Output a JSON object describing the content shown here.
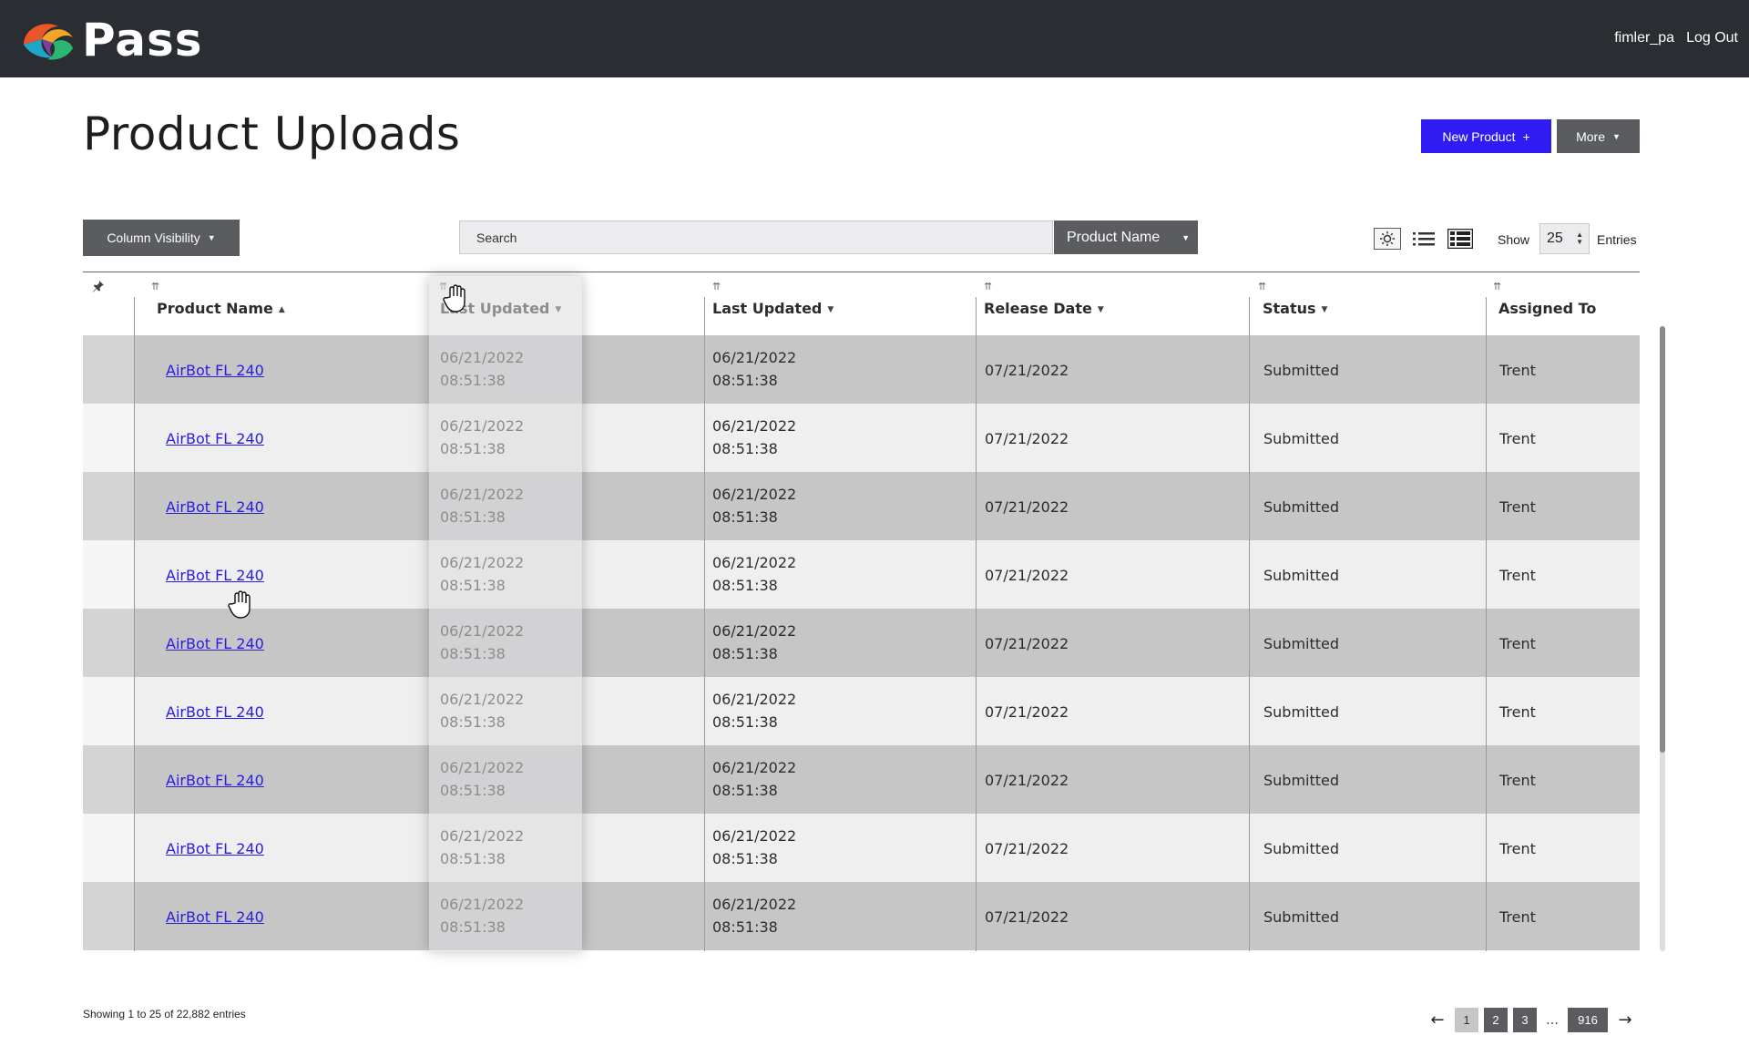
{
  "app": {
    "name": "Pass",
    "username": "fimler_pa",
    "logout_label": "Log Out"
  },
  "page": {
    "title": "Product Uploads",
    "new_product_label": "New Product",
    "new_product_icon": "+",
    "more_label": "More"
  },
  "toolbar": {
    "column_visibility_label": "Column Visibility",
    "search_placeholder": "Search",
    "search_field_label": "Product Name",
    "show_label": "Show",
    "show_value": "25",
    "entries_label": "Entries",
    "view_icons": [
      "brightness-icon",
      "list-view-icon",
      "table-view-icon"
    ]
  },
  "table": {
    "columns": [
      {
        "label": "Product Name",
        "sort": "desc"
      },
      {
        "label": "Last Updated",
        "sort": "desc"
      },
      {
        "label": "Last Updated",
        "sort": "desc"
      },
      {
        "label": "Release Date",
        "sort": "asc"
      },
      {
        "label": "Status",
        "sort": "desc"
      },
      {
        "label": "Assigned To",
        "sort": ""
      }
    ],
    "rows": [
      {
        "product": "AirBot FL 240",
        "updated1_date": "06/21/2022",
        "updated1_time": "08:51:38",
        "updated2_date": "06/21/2022",
        "updated2_time": "08:51:38",
        "release": "07/21/2022",
        "status": "Submitted",
        "assigned": "Trent"
      },
      {
        "product": "AirBot FL 240",
        "updated1_date": "06/21/2022",
        "updated1_time": "08:51:38",
        "updated2_date": "06/21/2022",
        "updated2_time": "08:51:38",
        "release": "07/21/2022",
        "status": "Submitted",
        "assigned": "Trent"
      },
      {
        "product": "AirBot FL 240",
        "updated1_date": "06/21/2022",
        "updated1_time": "08:51:38",
        "updated2_date": "06/21/2022",
        "updated2_time": "08:51:38",
        "release": "07/21/2022",
        "status": "Submitted",
        "assigned": "Trent"
      },
      {
        "product": "AirBot FL 240",
        "updated1_date": "06/21/2022",
        "updated1_time": "08:51:38",
        "updated2_date": "06/21/2022",
        "updated2_time": "08:51:38",
        "release": "07/21/2022",
        "status": "Submitted",
        "assigned": "Trent"
      },
      {
        "product": "AirBot FL 240",
        "updated1_date": "06/21/2022",
        "updated1_time": "08:51:38",
        "updated2_date": "06/21/2022",
        "updated2_time": "08:51:38",
        "release": "07/21/2022",
        "status": "Submitted",
        "assigned": "Trent"
      },
      {
        "product": "AirBot FL 240",
        "updated1_date": "06/21/2022",
        "updated1_time": "08:51:38",
        "updated2_date": "06/21/2022",
        "updated2_time": "08:51:38",
        "release": "07/21/2022",
        "status": "Submitted",
        "assigned": "Trent"
      },
      {
        "product": "AirBot FL 240",
        "updated1_date": "06/21/2022",
        "updated1_time": "08:51:38",
        "updated2_date": "06/21/2022",
        "updated2_time": "08:51:38",
        "release": "07/21/2022",
        "status": "Submitted",
        "assigned": "Trent"
      },
      {
        "product": "AirBot FL 240",
        "updated1_date": "06/21/2022",
        "updated1_time": "08:51:38",
        "updated2_date": "06/21/2022",
        "updated2_time": "08:51:38",
        "release": "07/21/2022",
        "status": "Submitted",
        "assigned": "Trent"
      },
      {
        "product": "AirBot FL 240",
        "updated1_date": "06/21/2022",
        "updated1_time": "08:51:38",
        "updated2_date": "06/21/2022",
        "updated2_time": "08:51:38",
        "release": "07/21/2022",
        "status": "Submitted",
        "assigned": "Trent"
      }
    ]
  },
  "footer": {
    "info": "Showing 1 to 25 of 22,882 entries",
    "prev_icon": "←",
    "next_icon": "→",
    "pages": [
      "1",
      "2",
      "3"
    ],
    "ellipsis": "…",
    "last_page": "916",
    "current_page": "1"
  },
  "colors": {
    "topbar": "#2a2d31",
    "accent": "#2f1cf2",
    "button_gray": "#5a5c5f",
    "row_dark": "#c6c6c7",
    "row_light": "#efeff0",
    "link": "#2a1ce0"
  }
}
